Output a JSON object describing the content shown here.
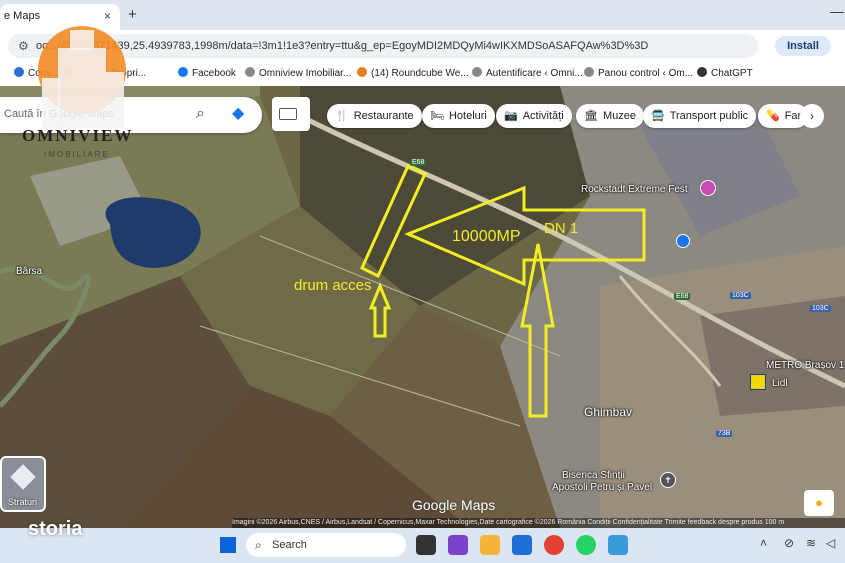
{
  "browser": {
    "tab_title": "e Maps",
    "tab_close": "×",
    "new_tab": "+",
    "minimize": "—",
    "url": "oo.../@45.6671439,25.4939783,1998m/data=!3m1!1e3?entry=ttu&g_ep=EgoyMDI2MDQyMi4wIKXMDSoASAFQAw%3D%3D",
    "install_label": "Install",
    "bookmarks": [
      {
        "label": "Conv...",
        "color": "#2b6cd6"
      },
      {
        "label": "...area Propri...",
        "color": "#c0392b"
      },
      {
        "label": "Facebook",
        "color": "#1877f2"
      },
      {
        "label": "Omniview Imobiliar...",
        "color": "#888888"
      },
      {
        "label": "(14) Roundcube We...",
        "color": "#e67e22"
      },
      {
        "label": "Autentificare ‹ Omni...",
        "color": "#888888"
      },
      {
        "label": "Panou control ‹ Om...",
        "color": "#888888"
      },
      {
        "label": "ChatGPT",
        "color": "#333333"
      }
    ]
  },
  "maps": {
    "search_placeholder": "Caută în Google Maps",
    "chips": [
      {
        "label": "Restaurante",
        "icon": "🍴"
      },
      {
        "label": "Hoteluri",
        "icon": "🛏"
      },
      {
        "label": "Activități",
        "icon": "📷"
      },
      {
        "label": "Muzee",
        "icon": "🏛"
      },
      {
        "label": "Transport public",
        "icon": "🚍"
      },
      {
        "label": "Farm",
        "icon": "💊"
      }
    ],
    "chip_next": "›",
    "layers_label": "Straturi",
    "google_maps_logo": "Google Maps",
    "attribution": "Imagini ©2026 Airbus,CNES / Airbus,Landsat / Copernicus,Maxar Technologies,Date cartografice ©2026    România    Condiții    Confidențialitate    Trimite feedback despre produs    100 m",
    "places": {
      "rockstadt": "Rockstadt Extreme Fest",
      "metro": "METRO Brașov 1",
      "lidl": "Lidl",
      "ghimbav": "Ghimbav",
      "church_line1": "Biserica Sfinții",
      "church_line2": "Apostoli Petru și Pavel",
      "barsa": "Bârsa"
    },
    "road_shields": {
      "e68_top": "E68",
      "e68_mid": "E68",
      "r103c_a": "103C",
      "r103c_b": "103C",
      "r73b": "73B"
    }
  },
  "annotations": {
    "area": "10000MP",
    "road": "DN 1",
    "access": "drum acces",
    "color": "#f1ee24"
  },
  "watermark": {
    "title": "OMNIVIEW",
    "subtitle": "IMOBILIARE"
  },
  "overlay": {
    "storia": "storia"
  },
  "taskbar": {
    "search_label": "Search"
  }
}
